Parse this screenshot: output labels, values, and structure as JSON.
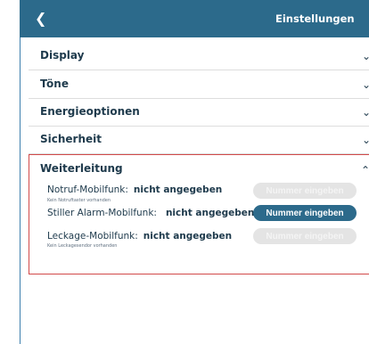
{
  "header": {
    "title": "Einstellungen",
    "back_icon": "chevron-left-icon"
  },
  "sections": [
    {
      "label": "Display",
      "icon": "chevron-down-icon"
    },
    {
      "label": "Töne",
      "icon": "chevron-down-icon"
    },
    {
      "label": "Energieoptionen",
      "icon": "chevron-down-icon"
    },
    {
      "label": "Sicherheit",
      "icon": "chevron-down-icon"
    }
  ],
  "forwarding": {
    "label": "Weiterleitung",
    "icon": "chevron-up-icon",
    "rows": [
      {
        "name": "Notruf-Mobilfunk:",
        "value": "nicht angegeben",
        "note": "Kein Notruftaster vorhanden",
        "button": "Nummer eingeben",
        "enabled": false
      },
      {
        "name": "Stiller Alarm-Mobilfunk:",
        "value": "nicht angegeben",
        "note": "",
        "button": "Nummer eingeben",
        "enabled": true
      },
      {
        "name": "Leckage-Mobilfunk:",
        "value": "nicht angegeben",
        "note": "Kein Leckagesendor vorhanden",
        "button": "Nummer eingeben",
        "enabled": false
      }
    ]
  },
  "colors": {
    "header": "#2c6a8b",
    "accent": "#2c6a8b",
    "highlight_border": "#d24a4a",
    "text": "#1e3a4c"
  }
}
